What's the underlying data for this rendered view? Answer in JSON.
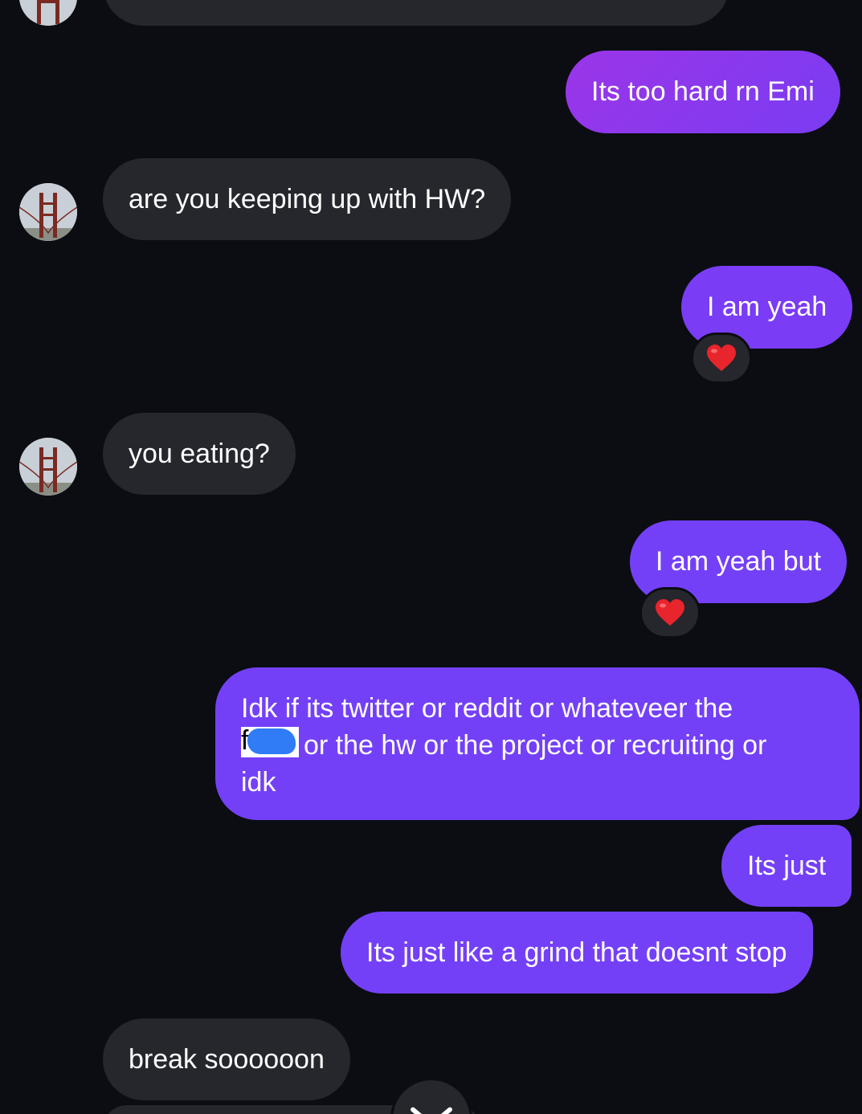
{
  "messages": {
    "m1": "Its too hard rn Emi",
    "m2": "are you keeping up with HW?",
    "m3": "I am yeah",
    "m4": "you eating?",
    "m5": "I am yeah but",
    "m6_line1": "Idk if its twitter or reddit or whateveer the",
    "m6_redacted_letter": "f",
    "m6_line2": "or the hw or the project or recruiting or",
    "m6_line3": "idk",
    "m7": "Its just",
    "m8": "Its just like a grind that doesnt stop",
    "m9": "break soooooon"
  },
  "reactions": {
    "r1": "heart-emoji",
    "r2": "heart-emoji"
  },
  "colors": {
    "background": "#0b0d12",
    "incoming_bubble": "#25272d",
    "outgoing_bubble": "#7440f7",
    "outgoing_gradient_top": "#9b35e8",
    "heart": "#e8242c"
  }
}
